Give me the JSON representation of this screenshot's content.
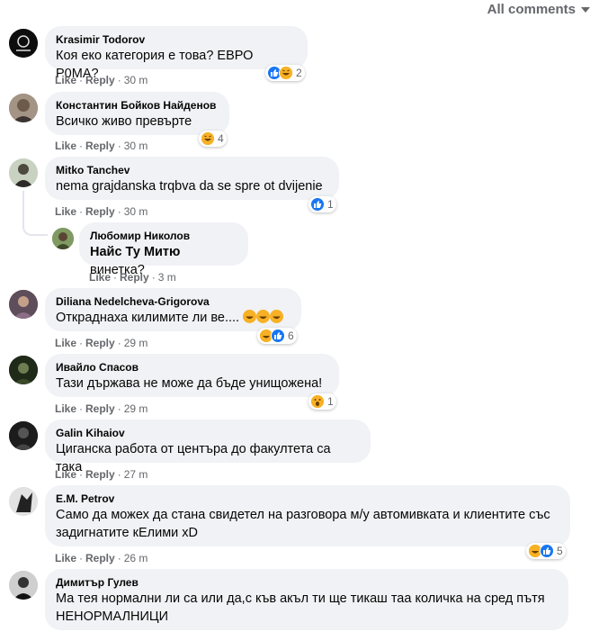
{
  "header": {
    "filter_label": "All comments"
  },
  "actions": {
    "like": "Like",
    "reply": "Reply"
  },
  "colors": {
    "like_blue": "#1877f2",
    "haha_yellow": "#f7b125",
    "bubble_bg": "#f0f2f5",
    "meta_gray": "#65676b"
  },
  "comments": [
    {
      "author": "Krasimir Todorov",
      "text": "Коя еко категория е това? ЕВРО Р0МА?",
      "time": "30 m",
      "reactions": [
        "like",
        "haha"
      ],
      "count": "2"
    },
    {
      "author": "Константин Бойков Найденов",
      "text": "Всичко живо превърте",
      "time": "30 m",
      "reactions": [
        "haha"
      ],
      "count": "4"
    },
    {
      "author": "Mitko Tanchev",
      "text": "nema grajdanska trqbva da se spre ot dvijenie",
      "time": "30 m",
      "reactions": [
        "like"
      ],
      "count": "1"
    },
    {
      "author": "Любомир Николов",
      "mention": "Найс Ту Митю",
      "text": " винетка?",
      "time": "3 m"
    },
    {
      "author": "Diliana Nedelcheva-Grigorova",
      "text": "Откраднаха килимите ли ве....",
      "emoji_trail": [
        "haha",
        "haha",
        "haha"
      ],
      "time": "29 m",
      "reactions": [
        "haha",
        "like"
      ],
      "count": "6"
    },
    {
      "author": "Ивайло Спасов",
      "text": "Тази държава не може да бъде унищожена!",
      "time": "29 m",
      "reactions": [
        "wow"
      ],
      "count": "1"
    },
    {
      "author": "Galin Kihaiov",
      "text": "Циганска работа от центъра до факултета са така",
      "time": "27 m"
    },
    {
      "author": "E.M. Petrov",
      "text_line1": "Само да можех да стана свидетел на разговора м/у автомивката и клиентите със",
      "text_line2": "задигнатите кЕлими xD",
      "time": "26 m",
      "reactions": [
        "haha",
        "like"
      ],
      "count": "5"
    },
    {
      "author": "Димитър Гулев",
      "text_line1": "Ма тея нормални ли са или да,с къв акъл ти ще тикаш таа количка на сред пътя",
      "text_line2": "НЕНОРМАЛНИЦИ"
    }
  ]
}
